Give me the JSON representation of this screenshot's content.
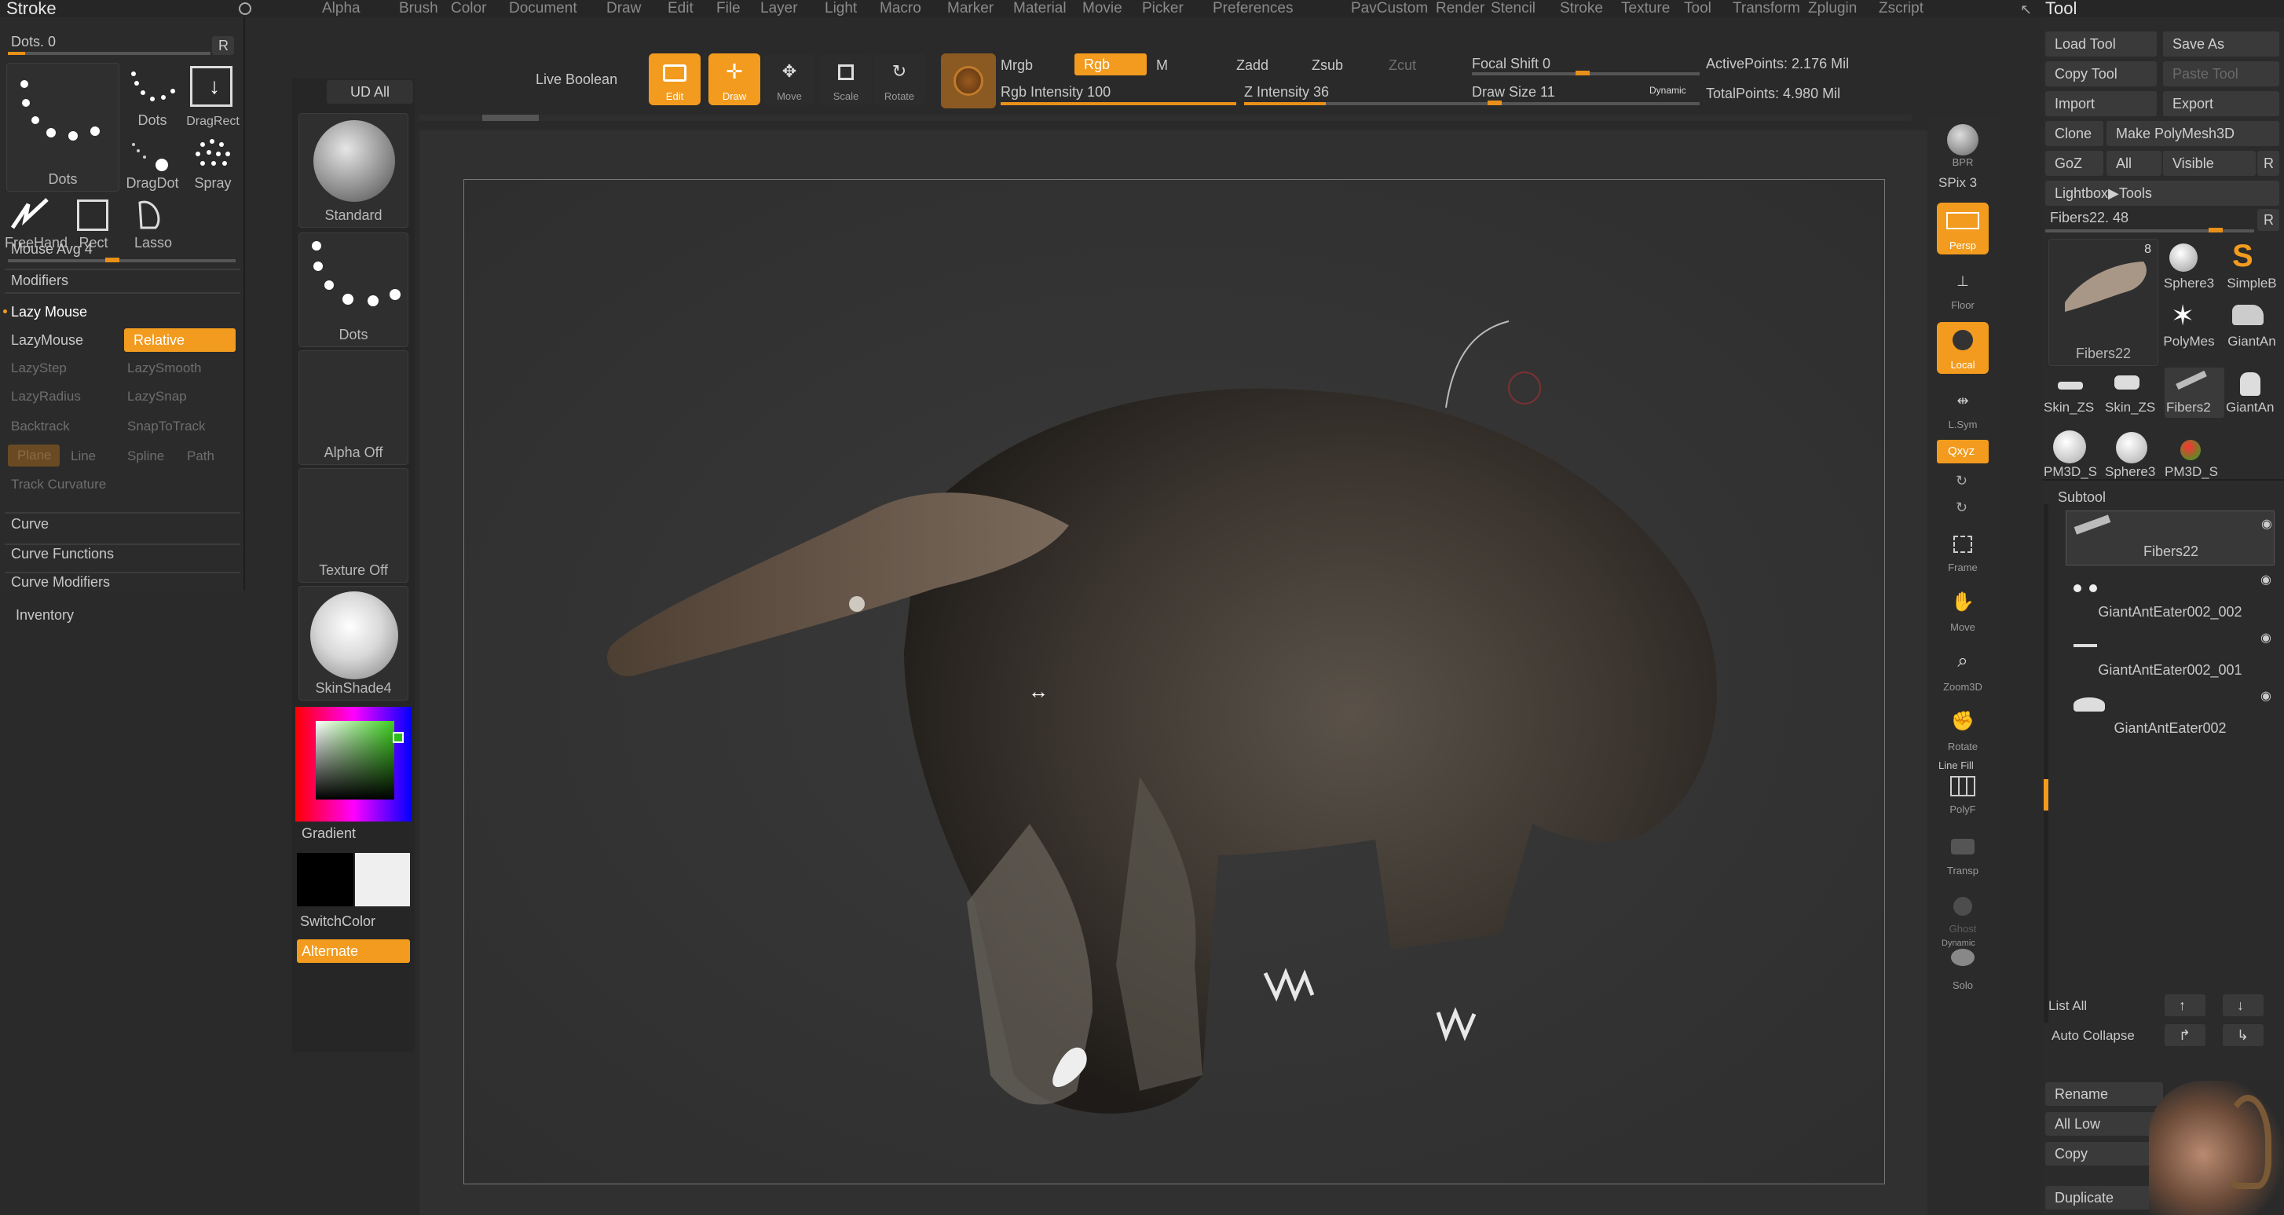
{
  "menubar": [
    "Alpha",
    "Brush",
    "Color",
    "Document",
    "Draw",
    "Edit",
    "File",
    "Layer",
    "Light",
    "Macro",
    "Marker",
    "Material",
    "Movie",
    "Picker",
    "Preferences",
    "PavCustom",
    "Render",
    "Stencil",
    "Stroke",
    "Texture",
    "Tool",
    "Transform",
    "Zplugin",
    "Zscript"
  ],
  "stroke": {
    "title": "Stroke",
    "dots_label": "Dots. 0",
    "r_label": "R",
    "types": [
      "Dots",
      "Dots",
      "DragRect",
      "DragDot",
      "Spray",
      "FreeHand",
      "Rect",
      "Lasso"
    ],
    "mouse_avg": "Mouse Avg 4",
    "modifiers": "Modifiers",
    "lazy_mouse": "Lazy Mouse",
    "lazymouse_btn": "LazyMouse",
    "relative_btn": "Relative",
    "lazystep": "LazyStep",
    "lazysmooth": "LazySmooth",
    "lazyradius": "LazyRadius",
    "lazysnap": "LazySnap",
    "backtrack": "Backtrack",
    "snaptotrack": "SnapToTrack",
    "plane": "Plane",
    "line": "Line",
    "spline": "Spline",
    "path": "Path",
    "track_curvature": "Track Curvature",
    "curve": "Curve",
    "curve_functions": "Curve Functions",
    "curve_modifiers": "Curve Modifiers",
    "inventory": "Inventory"
  },
  "shelf": {
    "ud_all": "UD All",
    "standard": "Standard",
    "dots": "Dots",
    "alpha_off": "Alpha Off",
    "texture_off": "Texture Off",
    "material": "SkinShade4",
    "gradient": "Gradient",
    "switch_color": "SwitchColor",
    "alternate": "Alternate"
  },
  "top": {
    "live_boolean": "Live Boolean",
    "edit": "Edit",
    "draw": "Draw",
    "move": "Move",
    "scale": "Scale",
    "rotate": "Rotate",
    "mrgb": "Mrgb",
    "rgb": "Rgb",
    "m": "M",
    "rgb_intensity": "Rgb Intensity 100",
    "zadd": "Zadd",
    "zsub": "Zsub",
    "zcut": "Zcut",
    "z_intensity": "Z Intensity 36",
    "focal_shift": "Focal Shift 0",
    "draw_size": "Draw Size 11",
    "dynamic": "Dynamic",
    "active_points": "ActivePoints: 2.176 Mil",
    "total_points": "TotalPoints: 4.980 Mil",
    "rgb_intensity_level": 1.0,
    "z_intensity_level": 0.36
  },
  "rightbar": [
    "BPR",
    "SPix 3",
    "Persp",
    "Floor",
    "Local",
    "L.Sym",
    "Qxyz",
    "Frame",
    "Move",
    "Zoom3D",
    "Rotate",
    "Line Fill",
    "PolyF",
    "Transp",
    "Ghost",
    "Dynamic",
    "Solo"
  ],
  "tool": {
    "title": "Tool",
    "load_tool": "Load Tool",
    "save_as": "Save As",
    "copy_tool": "Copy Tool",
    "paste_tool": "Paste Tool",
    "import": "Import",
    "export": "Export",
    "clone": "Clone",
    "make_polymesh": "Make PolyMesh3D",
    "goz": "GoZ",
    "all": "All",
    "visible": "Visible",
    "r": "R",
    "lightbox": "Lightbox▶Tools",
    "fibers_slider": "Fibers22. 48",
    "current_tool": "Fibers22",
    "badge": "8",
    "thumbs": [
      "Sphere3",
      "SimpleB",
      "PolyMes",
      "GiantAn",
      "Skin_ZS",
      "Skin_ZS",
      "Fibers2",
      "GiantAn",
      "PM3D_S",
      "Sphere3",
      "PM3D_S"
    ],
    "subtool": "Subtool",
    "subtools": [
      "Fibers22",
      "GiantAntEater002_002",
      "GiantAntEater002_001",
      "GiantAntEater002"
    ],
    "list_all": "List All",
    "auto_collapse": "Auto Collapse",
    "rename": "Rename",
    "all_low": "All Low",
    "copy": "Copy",
    "duplicate": "Duplicate"
  },
  "colors": {
    "accent": "#f29b1e",
    "panel": "#2b2b2b",
    "canvas": "#333333"
  }
}
